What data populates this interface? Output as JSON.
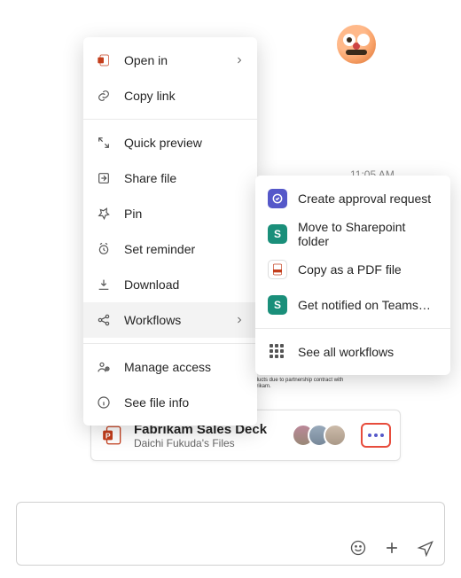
{
  "timestamp": "11:05 AM",
  "preview_text": "Fabrikam's worldwide sales topped $300M. Of that, 36.7% was from the sales of that category. 62.5% of VanArsdel sales were of Fabrikam products due to partnership contract with Fabrikam.",
  "file": {
    "title": "Fabrikam Sales Deck",
    "subtitle": "Daichi Fukuda's Files"
  },
  "context_menu": {
    "open_in": "Open in",
    "copy_link": "Copy link",
    "quick_preview": "Quick preview",
    "share_file": "Share file",
    "pin": "Pin",
    "set_reminder": "Set reminder",
    "download": "Download",
    "workflows": "Workflows",
    "manage_access": "Manage access",
    "see_file_info": "See file info"
  },
  "workflows_submenu": {
    "create_approval": "Create approval request",
    "move_sharepoint": "Move to Sharepoint folder",
    "copy_pdf": "Copy as a PDF file",
    "get_notified": "Get notified on Teams…",
    "see_all": "See all workflows"
  }
}
